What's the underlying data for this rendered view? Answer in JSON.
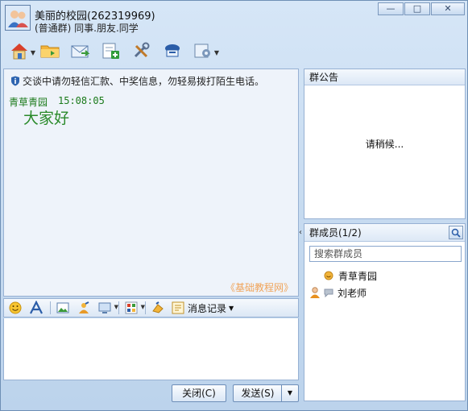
{
  "window": {
    "group_name": "美丽的校园(262319969)",
    "group_type": "(普通群) 同事.朋友.同学",
    "buttons": {
      "minimize": "—",
      "maximize": "□",
      "close": "✕"
    }
  },
  "toolbar": {
    "items": [
      {
        "icon": "home-icon",
        "has_dropdown": true
      },
      {
        "icon": "folder-icon",
        "has_dropdown": false
      },
      {
        "icon": "mail-icon",
        "has_dropdown": false
      },
      {
        "icon": "add-icon",
        "has_dropdown": false
      },
      {
        "icon": "tools-icon",
        "has_dropdown": false
      },
      {
        "icon": "chat-icon",
        "has_dropdown": false
      },
      {
        "icon": "settings-icon",
        "has_dropdown": true
      }
    ]
  },
  "chat": {
    "notice": "交谈中请勿轻信汇款、中奖信息，勿轻易拨打陌生电话。",
    "messages": [
      {
        "sender": "青草青园",
        "time": "15:08:05",
        "text": "大家好"
      }
    ],
    "watermark": "《基础教程网》"
  },
  "input_toolbar": {
    "message_log_label": "消息记录"
  },
  "actions": {
    "close_label": "关闭(C)",
    "send_label": "发送(S)"
  },
  "announcement": {
    "title": "群公告",
    "loading_text": "请稍候..."
  },
  "members": {
    "title": "群成员(1/2)",
    "search_placeholder": "搜索群成员",
    "list": [
      {
        "name": "青草青园"
      },
      {
        "name": "刘老师"
      }
    ]
  },
  "colors": {
    "sender_green": "#1a7a1a",
    "watermark_orange": "#f0a45a",
    "window_blue": "#c4d9ef"
  }
}
